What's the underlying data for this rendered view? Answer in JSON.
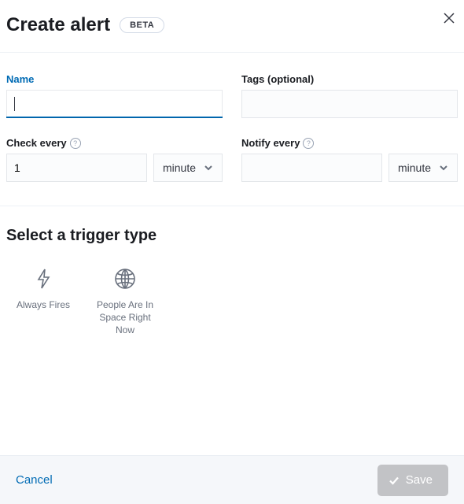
{
  "header": {
    "title": "Create alert",
    "badge": "BETA"
  },
  "form": {
    "name": {
      "label": "Name",
      "value": ""
    },
    "tags": {
      "label": "Tags (optional)",
      "value": ""
    },
    "check_every": {
      "label": "Check every",
      "value": "1",
      "unit": "minute"
    },
    "notify_every": {
      "label": "Notify every",
      "value": "",
      "unit": "minute"
    }
  },
  "trigger_section": {
    "title": "Select a trigger type",
    "options": [
      {
        "label": "Always Fires"
      },
      {
        "label": "People Are In Space Right Now"
      }
    ]
  },
  "footer": {
    "cancel": "Cancel",
    "save": "Save"
  }
}
